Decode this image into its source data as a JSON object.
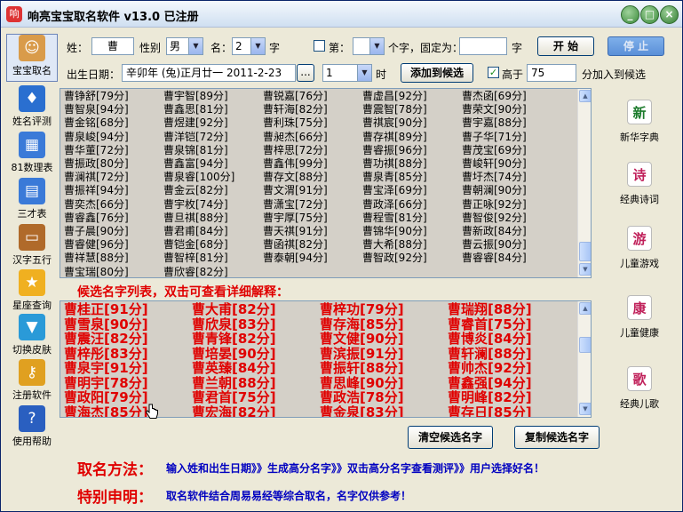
{
  "window": {
    "title": "响亮宝宝取名软件 v13.0   已注册",
    "app_icon": "app-logo-icon",
    "min_label": "_",
    "max_label": "□",
    "close_label": "×"
  },
  "left_toolbar": [
    {
      "label": "宝宝取名",
      "icon": "baby-name-icon",
      "color": "#d99b4a",
      "glyph": "☺"
    },
    {
      "label": "姓名评测",
      "icon": "name-test-icon",
      "color": "#2a6fd0",
      "glyph": "♦"
    },
    {
      "label": "81数理表",
      "icon": "number-table-icon",
      "color": "#3a7ad8",
      "glyph": "▦"
    },
    {
      "label": "三才表",
      "icon": "three-talent-icon",
      "color": "#3a7ad8",
      "glyph": "▤"
    },
    {
      "label": "汉字五行",
      "icon": "book-icon",
      "color": "#b06a2a",
      "glyph": "▭"
    },
    {
      "label": "星座查询",
      "icon": "star-icon",
      "color": "#f0b020",
      "glyph": "★"
    },
    {
      "label": "切换皮肤",
      "icon": "shirt-icon",
      "color": "#2a9ad8",
      "glyph": "▼"
    },
    {
      "label": "注册软件",
      "icon": "key-icon",
      "color": "#e0a020",
      "glyph": "⚷"
    },
    {
      "label": "使用帮助",
      "icon": "help-icon",
      "color": "#2a5fc0",
      "glyph": "?"
    }
  ],
  "right_toolbar": [
    {
      "label": "新华字典",
      "icon": "dictionary-icon",
      "glyph": "新",
      "color": "#1a7a2a"
    },
    {
      "label": "经典诗词",
      "icon": "poetry-icon",
      "glyph": "诗",
      "color": "#c0205a"
    },
    {
      "label": "儿童游戏",
      "icon": "game-icon",
      "glyph": "游",
      "color": "#c0205a"
    },
    {
      "label": "儿童健康",
      "icon": "health-icon",
      "glyph": "康",
      "color": "#c0205a"
    },
    {
      "label": "经典儿歌",
      "icon": "song-icon",
      "glyph": "歌",
      "color": "#c0205a"
    }
  ],
  "form": {
    "surname_label": "姓：",
    "surname_value": "曹",
    "gender_label": "性别",
    "gender_value": "男",
    "name_label": "名：",
    "name_count": "2",
    "name_unit": "字",
    "fixed_prefix": "第：",
    "fixed_mid": "个字，固定为：",
    "fixed_unit": "字",
    "start_button": "开  始",
    "stop_button": "停  止",
    "birth_label": "出生日期：",
    "birth_value": "辛卯年 (兔)正月廿一  2011-2-23",
    "birth_picker": "...",
    "hour_value": "1",
    "hour_unit": "时",
    "add_button": "添加到候选",
    "above_label": "高于",
    "above_value": "75",
    "above_suffix": "分加入到候选"
  },
  "names_grid": [
    [
      "曹铮舒[79分]",
      "曹宇智[89分]",
      "曹锐嘉[76分]",
      "曹虚昌[92分]",
      "曹杰函[69分]"
    ],
    [
      "曹智泉[94分]",
      "曹鑫思[81分]",
      "曹轩海[82分]",
      "曹震智[78分]",
      "曹荣文[90分]"
    ],
    [
      "曹金铭[68分]",
      "曹煜建[92分]",
      "曹利珠[75分]",
      "曹祺宸[90分]",
      "曹宇嘉[88分]"
    ],
    [
      "曹泉峻[94分]",
      "曹洋铠[72分]",
      "曹昶杰[66分]",
      "曹存祺[89分]",
      "曹子华[71分]"
    ],
    [
      "曹华董[72分]",
      "曹泉锦[81分]",
      "曹梓思[72分]",
      "曹睿振[96分]",
      "曹茂宝[69分]"
    ],
    [
      "曹振政[80分]",
      "曹鑫富[94分]",
      "曹鑫伟[99分]",
      "曹功祺[88分]",
      "曹峻轩[90分]"
    ],
    [
      "曹澜祺[72分]",
      "曹泉睿[100分]",
      "曹存文[88分]",
      "曹泉青[85分]",
      "曹圩杰[74分]"
    ],
    [
      "曹振祥[94分]",
      "曹金云[82分]",
      "曹文渭[91分]",
      "曹宝泽[69分]",
      "曹朝澜[90分]"
    ],
    [
      "曹奕杰[66分]",
      "曹宇枚[74分]",
      "曹潇宝[72分]",
      "曹政泽[66分]",
      "曹正咏[92分]"
    ],
    [
      "曹睿鑫[76分]",
      "曹旦祺[88分]",
      "曹宇厚[75分]",
      "曹程雪[81分]",
      "曹智俊[92分]"
    ],
    [
      "曹子晨[90分]",
      "曹君甫[84分]",
      "曹天祺[91分]",
      "曹锦华[90分]",
      "曹新政[84分]"
    ],
    [
      "曹睿健[96分]",
      "曹铠金[68分]",
      "曹函祺[82分]",
      "曹大希[88分]",
      "曹云振[90分]"
    ],
    [
      "曹祥慧[88分]",
      "曹智梓[81分]",
      "曹泰朝[94分]",
      "曹智政[92分]",
      "曹睿睿[84分]"
    ],
    [
      "曹宝瑞[80分]",
      "曹欣睿[82分]",
      "",
      "",
      ""
    ]
  ],
  "candidates": {
    "heading": "候选名字列表，双击可查看详细解释：",
    "rows": [
      [
        "曹桂正[91分]",
        "曹大甫[82分]",
        "曹梓功[79分]",
        "曹瑞翔[88分]"
      ],
      [
        "曹雪泉[90分]",
        "曹欣泉[83分]",
        "曹存海[85分]",
        "曹睿首[75分]"
      ],
      [
        "曹震汪[82分]",
        "曹青锋[82分]",
        "曹文健[90分]",
        "曹博炎[84分]"
      ],
      [
        "曹梓彤[83分]",
        "曹培晏[90分]",
        "曹滨振[91分]",
        "曹轩澜[88分]"
      ],
      [
        "曹泉宇[91分]",
        "曹英臻[84分]",
        "曹振轩[88分]",
        "曹帅杰[92分]"
      ],
      [
        "曹明宇[78分]",
        "曹兰朝[88分]",
        "曹思峰[90分]",
        "曹鑫强[94分]"
      ],
      [
        "曹政阳[79分]",
        "曹君首[75分]",
        "曹政浩[78分]",
        "曹明峰[82分]"
      ],
      [
        "曹海杰[85分]",
        "曹宏海[82分]",
        "曹金泉[83分]",
        "曹存日[85分]"
      ]
    ],
    "clear_button": "清空候选名字",
    "copy_button": "复制候选名字"
  },
  "footer": {
    "method_label": "取名方法：",
    "method_text": "输入姓和出生日期》》生成高分名字》》双击高分名字查看测评》》用户选择好名！",
    "note_label": "特别申明：",
    "note_text": "取名软件结合周易易经等综合取名，名字仅供参考！"
  }
}
